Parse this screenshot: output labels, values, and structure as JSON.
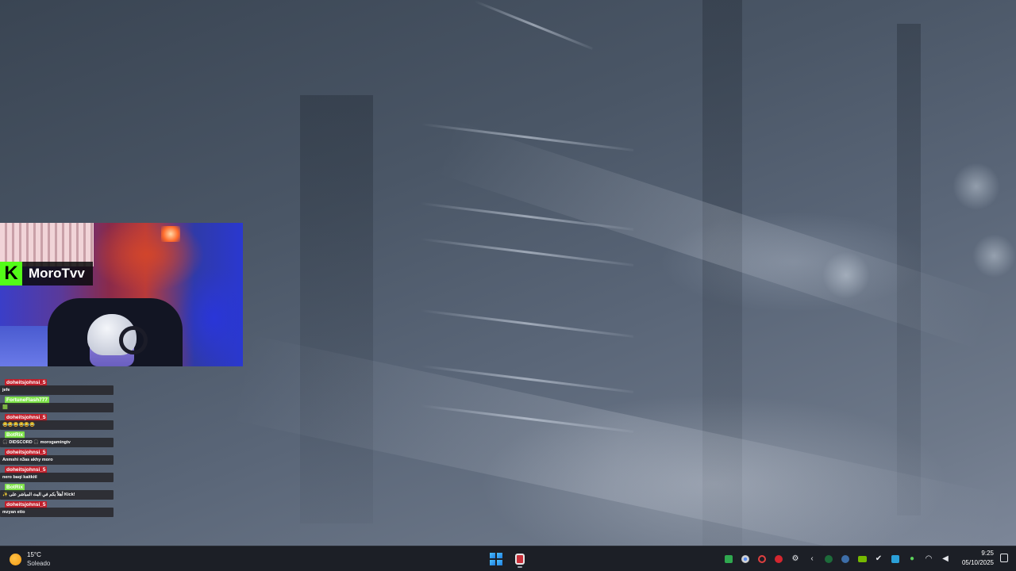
{
  "overlay": {
    "streamer_name": "MoroTvv",
    "platform_logo_letter": "K",
    "platform_color": "#53fc18"
  },
  "chat": {
    "messages": [
      {
        "user": "doheitsjohnsi_5",
        "user_color": "#c1202c",
        "text": "jefe"
      },
      {
        "user": "FortuneFlash777",
        "user_color": "#7ee34a",
        "text": "🟩"
      },
      {
        "user": "doheitsjohnsi_5",
        "user_color": "#c1202c",
        "text": "😂😂😂😂😂😂"
      },
      {
        "user": "BotRix",
        "user_color": "#7ee34a",
        "text": "🎧 DIDSCORD 🎧 morogamingtv"
      },
      {
        "user": "doheitsjohnsi_5",
        "user_color": "#c1202c",
        "text": "Anmshi n3as akhy moro"
      },
      {
        "user": "doheitsjohnsi_5",
        "user_color": "#c1202c",
        "text": "nero baqi kaitkitl"
      },
      {
        "user": "BotRix",
        "user_color": "#7ee34a",
        "text": "✨ أهلاً بكم في البث المباشر على Kick!"
      },
      {
        "user": "doheitsjohnsi_5",
        "user_color": "#c1202c",
        "text": "mzyan etio"
      }
    ]
  },
  "taskbar": {
    "weather": {
      "temperature": "15°C",
      "condition": "Soleado",
      "icon": "sun-icon"
    },
    "start_icon": "windows-start-icon",
    "pinned_app_icon": "app-icon",
    "tray_icons": [
      "app-green-icon",
      "chrome-icon",
      "app-red-icon",
      "app-red2-icon",
      "settings-icon",
      "chevron-left-icon",
      "app-green2-icon",
      "steam-icon",
      "nvidia-icon",
      "check-icon",
      "shield-icon",
      "microphone-icon",
      "wifi-icon",
      "speaker-icon"
    ],
    "clock": {
      "time": "9:25",
      "date": "05/10/2025"
    },
    "notification_icon": "notification-icon"
  }
}
